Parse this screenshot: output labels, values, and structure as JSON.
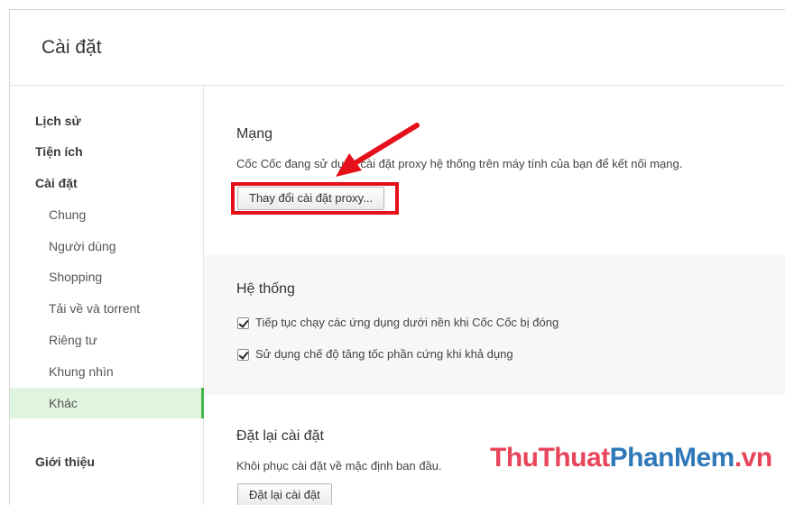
{
  "header": {
    "title": "Cài đặt"
  },
  "sidebar": {
    "items": [
      {
        "label": "Lịch sử"
      },
      {
        "label": "Tiện ích"
      },
      {
        "label": "Cài đặt"
      },
      {
        "label": "Chung"
      },
      {
        "label": "Người dùng"
      },
      {
        "label": "Shopping"
      },
      {
        "label": "Tải về và torrent"
      },
      {
        "label": "Riêng tư"
      },
      {
        "label": "Khung nhìn"
      },
      {
        "label": "Khác"
      },
      {
        "label": "Giới thiệu"
      }
    ],
    "active_item": "Khác"
  },
  "network": {
    "title": "Mạng",
    "description": "Cốc Cốc đang sử dụng cài đặt proxy hệ thống trên máy tính của bạn để kết nối mạng.",
    "proxy_button": "Thay đổi cài đặt proxy..."
  },
  "system": {
    "title": "Hệ thống",
    "options": [
      {
        "label": "Tiếp tục chạy các ứng dụng dưới nền khi Cốc Cốc bị đóng",
        "checked": true
      },
      {
        "label": "Sử dụng chế độ tăng tốc phần cứng khi khả dụng",
        "checked": true
      }
    ]
  },
  "reset": {
    "title": "Đặt lại cài đặt",
    "description": "Khôi phục cài đặt về mặc định ban đầu.",
    "button": "Đặt lại cài đặt"
  },
  "watermark": {
    "part1": "ThuThuat",
    "part2": "PhanMem",
    "part3": ".vn"
  },
  "colors": {
    "accent": "#48b648",
    "active_bg": "#dff5df",
    "annotation": "#e5101a"
  }
}
